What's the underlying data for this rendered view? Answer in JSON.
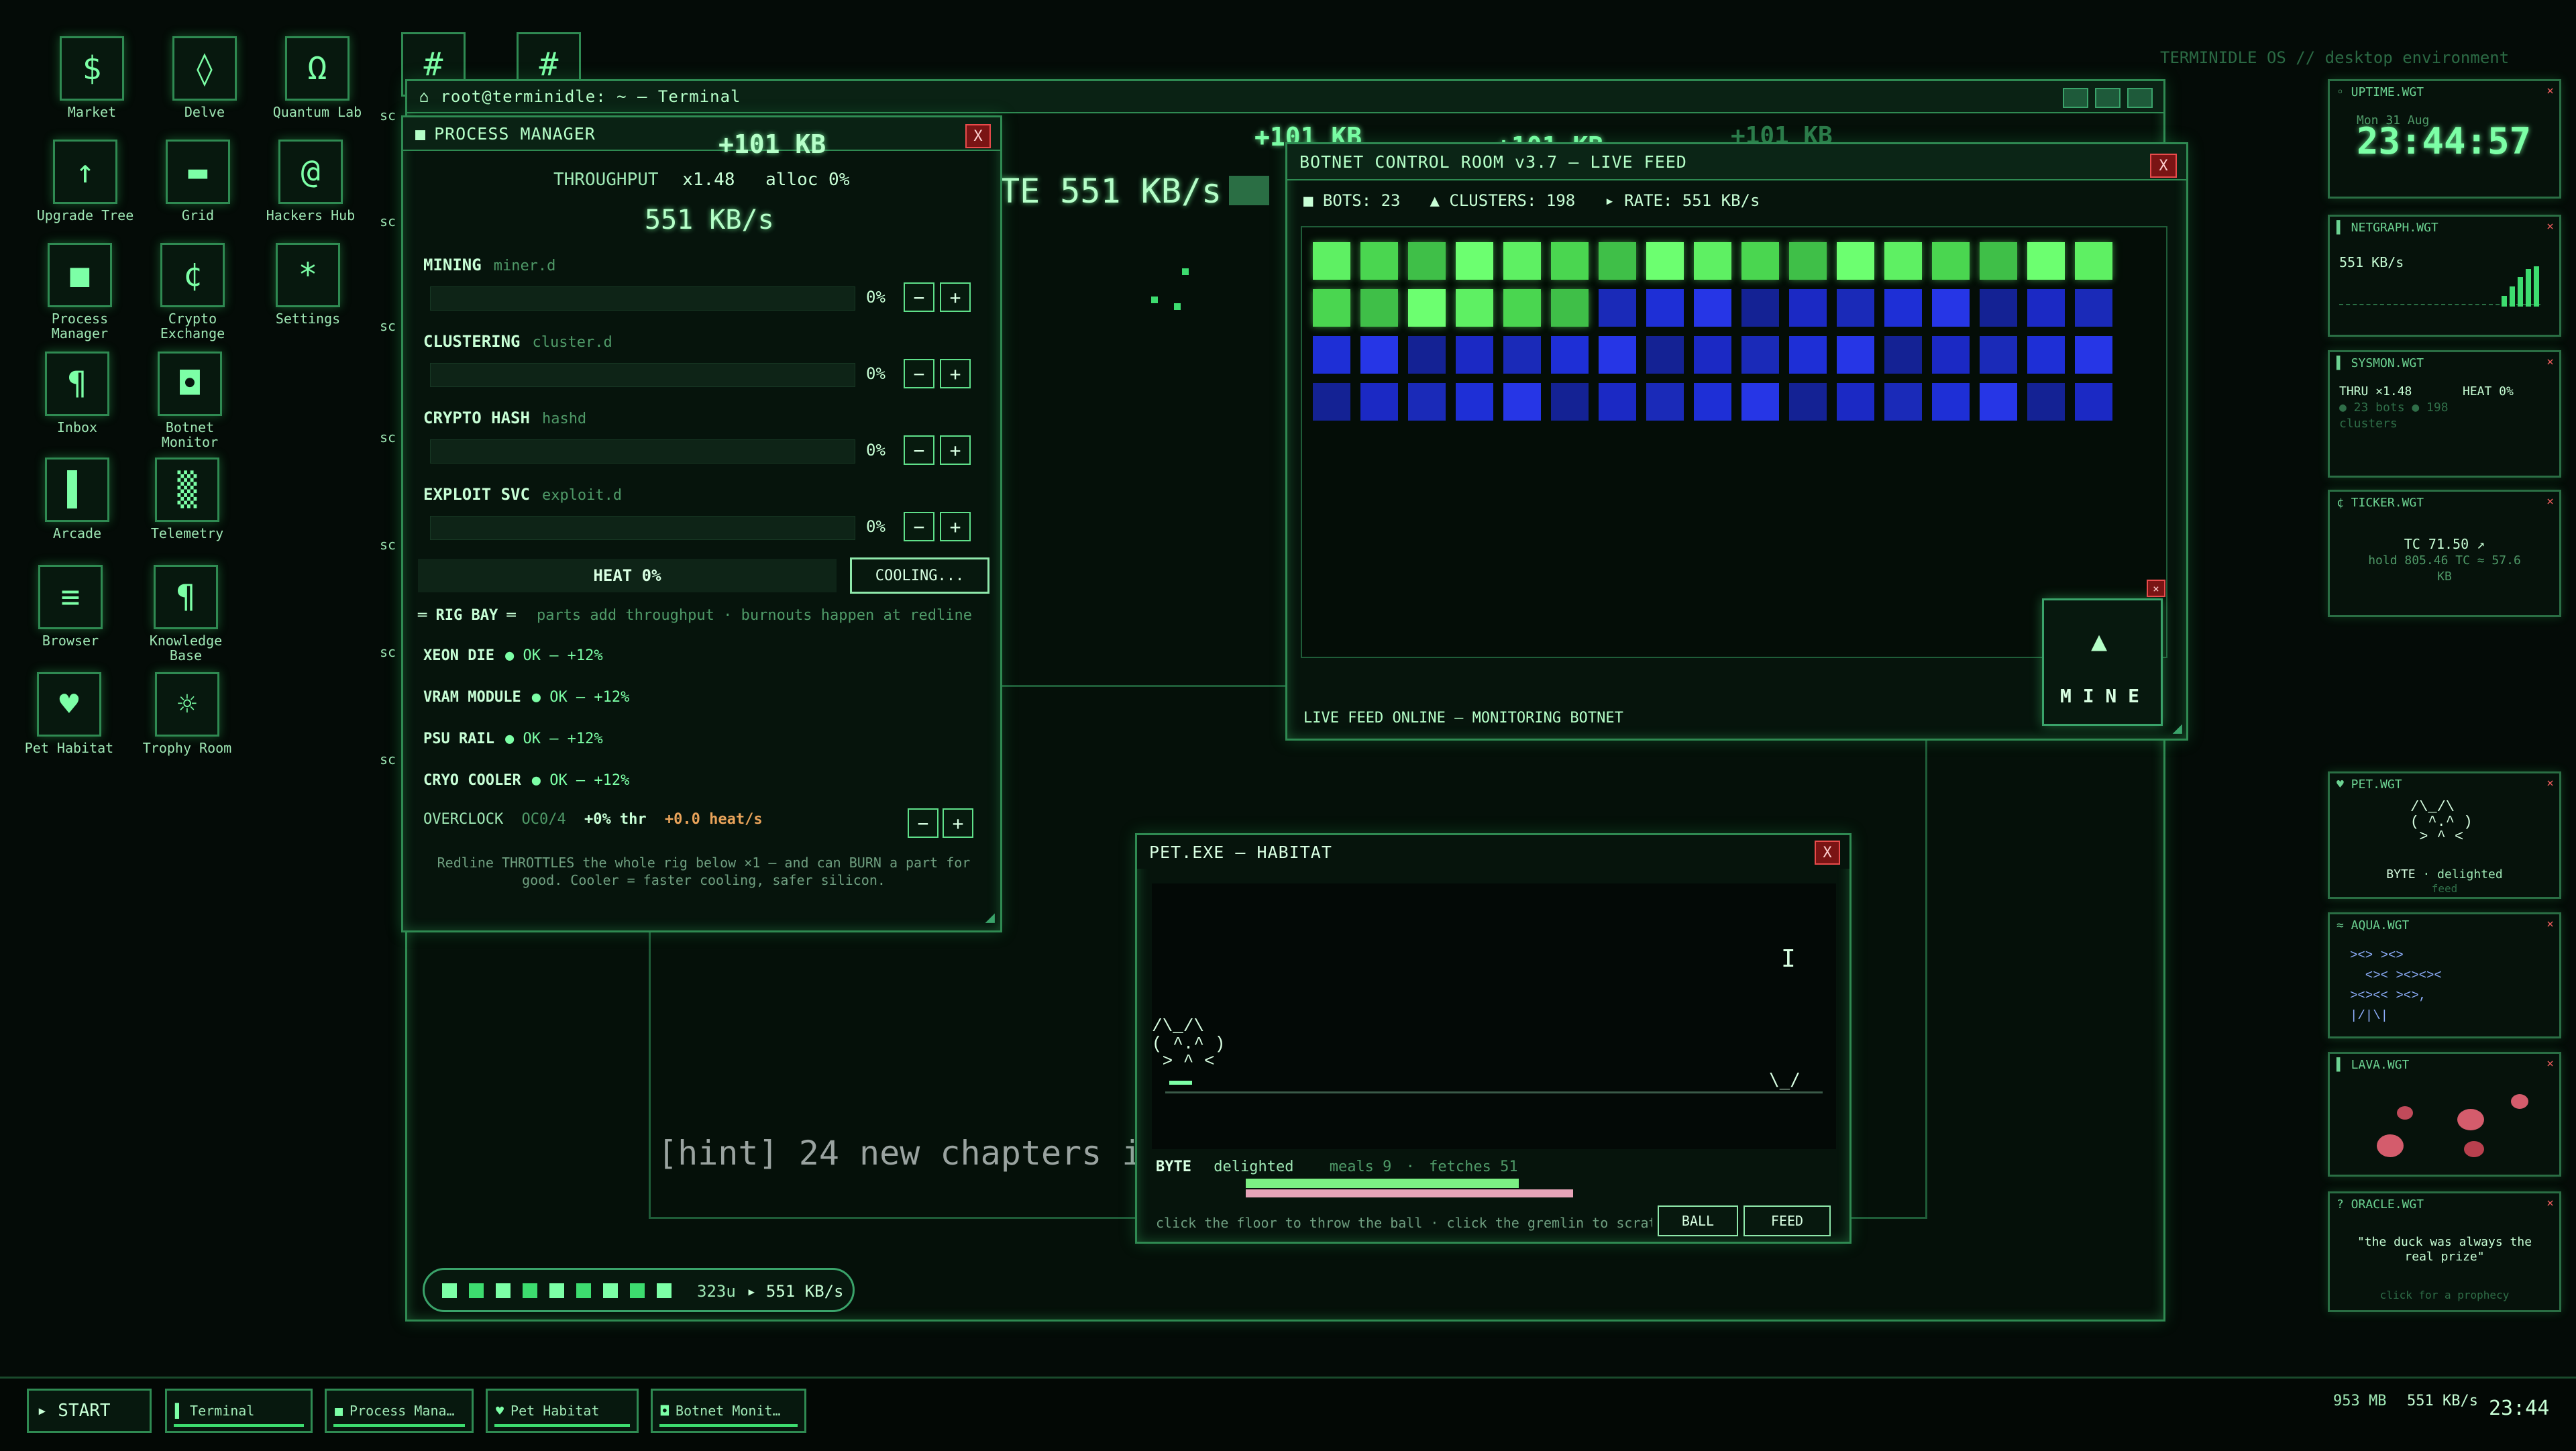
{
  "desktop": {
    "header": "TERMINIDLE OS  //  desktop environment",
    "icons": [
      {
        "label": "Market",
        "glyph": "$"
      },
      {
        "label": "Delve",
        "glyph": "◊"
      },
      {
        "label": "Quantum Lab",
        "glyph": "Ω"
      },
      {
        "label": "Upgrade Tree",
        "glyph": "↑"
      },
      {
        "label": "Grid",
        "glyph": "▬"
      },
      {
        "label": "Hackers Hub",
        "glyph": "@"
      },
      {
        "label": "Process Manager",
        "glyph": "■"
      },
      {
        "label": "Crypto Exchange",
        "glyph": "¢"
      },
      {
        "label": "Settings",
        "glyph": "*"
      },
      {
        "label": "Inbox",
        "glyph": "¶"
      },
      {
        "label": "Botnet Monitor",
        "glyph": "◘"
      },
      {
        "label": "Arcade",
        "glyph": "▌"
      },
      {
        "label": "Telemetry",
        "glyph": "▒"
      },
      {
        "label": "Browser",
        "glyph": "≡"
      },
      {
        "label": "Knowledge Base",
        "glyph": "¶"
      },
      {
        "label": "Pet Habitat",
        "glyph": "♥"
      },
      {
        "label": "Trophy Room",
        "glyph": "☼"
      }
    ],
    "hash_glyph": "#",
    "sc_label": "sc",
    "floating_kb": [
      "+101 KB",
      "+101 KB",
      "+101 KB",
      "+101 KB"
    ],
    "rate_banner": "TE 551 KB/s",
    "hint": "[hint] 24 new chapters in",
    "progress_pill": {
      "cells": 9,
      "units": "323u",
      "rate": "▸ 551 KB/s"
    }
  },
  "terminal": {
    "title": "root@terminidle: ~ — Terminal"
  },
  "process_manager": {
    "title": "PROCESS MANAGER",
    "kb_gain": "+101 KB",
    "throughput_label": "THROUGHPUT",
    "multiplier": "x1.48",
    "alloc": "alloc 0%",
    "rate": "551 KB/s",
    "processes": [
      {
        "name": "MINING",
        "proc": "miner.d",
        "pct": "0%"
      },
      {
        "name": "CLUSTERING",
        "proc": "cluster.d",
        "pct": "0%"
      },
      {
        "name": "CRYPTO HASH",
        "proc": "hashd",
        "pct": "0%"
      },
      {
        "name": "EXPLOIT SVC",
        "proc": "exploit.d",
        "pct": "0%"
      }
    ],
    "minus": "−",
    "plus": "+",
    "heat": "HEAT 0%",
    "cooling": "COOLING...",
    "rig_bay": "═ RIG BAY ═",
    "rig_note": "parts add throughput · burnouts happen at redline",
    "parts": [
      {
        "name": "XEON DIE",
        "status": "● OK — +12%"
      },
      {
        "name": "VRAM MODULE",
        "status": "● OK — +12%"
      },
      {
        "name": "PSU RAIL",
        "status": "● OK — +12%"
      },
      {
        "name": "CRYO COOLER",
        "status": "● OK — +12%"
      }
    ],
    "overclock": "OVERCLOCK",
    "oc_level": "OC0/4",
    "oc_thr": "+0% thr",
    "oc_heat": "+0.0 heat/s",
    "footer": "Redline THROTTLES the whole rig below ×1 — and can BURN a part for good. Cooler = faster cooling, safer silicon."
  },
  "botnet": {
    "title": "BOTNET CONTROL ROOM v3.7 — LIVE FEED",
    "bots": "■ BOTS: 23",
    "clusters": "▲ CLUSTERS: 198",
    "rate": "▸ RATE: 551 KB/s",
    "status": "LIVE FEED ONLINE — MONITORING BOTNET",
    "mine_label": "M I N E",
    "mine_icon": "▲",
    "grid": {
      "cols": 17,
      "bright_count": 23,
      "blue_count": 45,
      "green": "#5ef063",
      "blue": "#1e2fd6"
    }
  },
  "pet": {
    "title": "PET.EXE — HABITAT",
    "ascii": "/\\_/\\\n( ^.^ )\n > ^ <",
    "bowl": "\\_/",
    "cursor": "I",
    "name": "BYTE",
    "mood": "delighted",
    "meals": "meals 9",
    "fetches": "fetches 51",
    "hint": "click the floor to throw the ball · click the gremlin to scratch",
    "ball_btn": "BALL",
    "feed_btn": "FEED",
    "bar_green_pct": 55,
    "bar_pink_pct": 66
  },
  "widgets": {
    "uptime": {
      "title": "◦ UPTIME.WGT",
      "date": "Mon 31 Aug",
      "time": "23:44:57"
    },
    "netgraph": {
      "title": "▌ NETGRAPH.WGT",
      "rate": "551 KB/s"
    },
    "sysmon": {
      "title": "▌ SYSMON.WGT",
      "thru": "THRU ×1.48",
      "heat": "HEAT 0%",
      "line2": "● 23 bots  ● 198",
      "line3": "clusters"
    },
    "ticker": {
      "title": "¢ TICKER.WGT",
      "line1": "TC 71.50 ↗",
      "line2": "hold 805.46 TC ≈ 57.6",
      "line3": "KB"
    },
    "pet": {
      "title": "♥ PET.WGT",
      "ascii": "/\\_/\\\n( ^.^ )\n > ^ <",
      "name": "BYTE",
      "mood": "delighted",
      "feed": "feed"
    },
    "aqua": {
      "title": "≈ AQUA.WGT",
      "fish": "><> ><>\n  <>< ><><>< \n><><< ><>,\n|/|\\|"
    },
    "lava": {
      "title": "▌ LAVA.WGT"
    },
    "oracle": {
      "title": "? ORACLE.WGT",
      "quote": "\"the duck was always the real prize\"",
      "hint": "click for a prophecy"
    },
    "close": "×"
  },
  "taskbar": {
    "start": "▸ START",
    "items": [
      "Terminal",
      "Process Mana…",
      "Pet Habitat",
      "Botnet Monit…"
    ],
    "item_icons": [
      "▌",
      "■",
      "♥",
      "◘"
    ],
    "mem": "953 MB",
    "rate": "551 KB/s",
    "clock": "23:44"
  },
  "colors": {
    "accent": "#5fe08a",
    "red": "#e84b4b",
    "blue": "#1e2fd6"
  }
}
